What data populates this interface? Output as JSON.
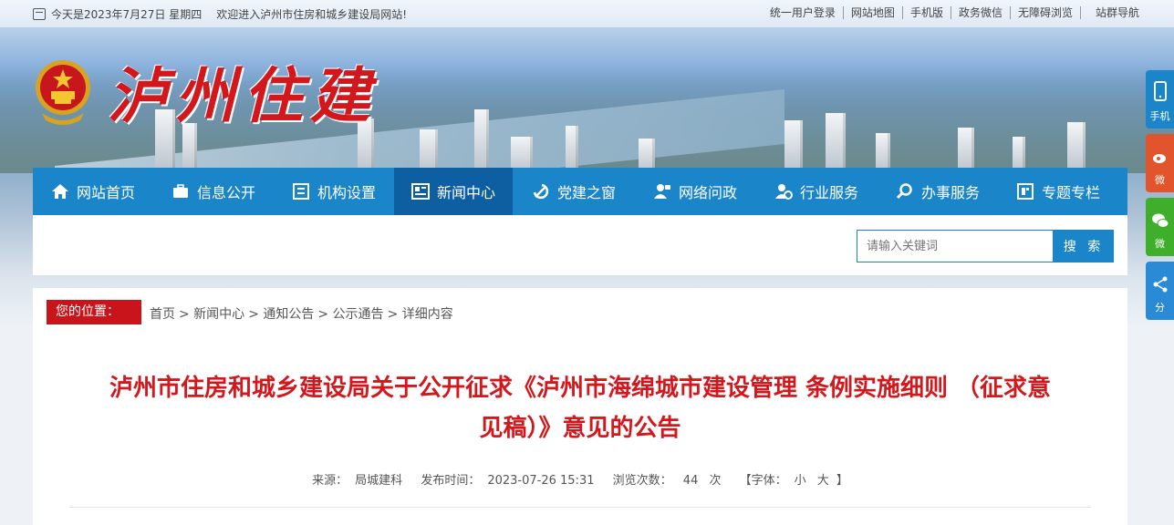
{
  "topbar": {
    "date_text": "今天是2023年7月27日 星期四",
    "welcome": "欢迎进入泸州市住房和城乡建设局网站!",
    "links": [
      "统一用户登录",
      "网站地图",
      "手机版",
      "政务微信",
      "无障碍浏览",
      "站群导航"
    ]
  },
  "logo": {
    "text": "泸州住建"
  },
  "nav": {
    "items": [
      {
        "label": "网站首页",
        "icon": "home-icon"
      },
      {
        "label": "信息公开",
        "icon": "briefcase-icon"
      },
      {
        "label": "机构设置",
        "icon": "org-icon"
      },
      {
        "label": "新闻中心",
        "icon": "news-icon"
      },
      {
        "label": "党建之窗",
        "icon": "party-icon"
      },
      {
        "label": "网络问政",
        "icon": "user-chat-icon"
      },
      {
        "label": "行业服务",
        "icon": "service-icon"
      },
      {
        "label": "办事服务",
        "icon": "search-icon"
      },
      {
        "label": "专题专栏",
        "icon": "topic-icon"
      }
    ],
    "active_index": 3,
    "bg_color": "#1a86c9",
    "active_color": "#0e5fa1"
  },
  "search": {
    "placeholder": "请输入关键词",
    "button": "搜 索"
  },
  "breadcrumb": {
    "label": "您的位置：",
    "items": [
      "首页",
      "> 新闻中心",
      "> 通知公告",
      "> 公示通告",
      "> 详细内容"
    ]
  },
  "article": {
    "title_line1": "泸州市住房和城乡建设局关于公开征求《泸州市海绵城市建设管理 条例实施细则 （征求意",
    "title_line2": "见稿）》意见的公告",
    "source_label": "来源：",
    "source": "局城建科",
    "date_label": "发布时间：",
    "date": "2023-07-26 15:31",
    "views_label": "浏览次数：",
    "views": "44",
    "views_unit": "次",
    "font_label": "【字体：",
    "font_small": "小",
    "font_large": "大",
    "font_close": "】",
    "title_color": "#d3181d"
  },
  "sidebar": {
    "items": [
      {
        "label": "手机",
        "icon": "mobile-icon",
        "color": "#1a86c9"
      },
      {
        "label": "微",
        "icon": "weibo-icon",
        "color": "#e2542b"
      },
      {
        "label": "微",
        "icon": "wechat-icon",
        "color": "#3fae2a"
      },
      {
        "label": "分",
        "icon": "share-icon",
        "color": "#2b8ad6"
      }
    ]
  }
}
